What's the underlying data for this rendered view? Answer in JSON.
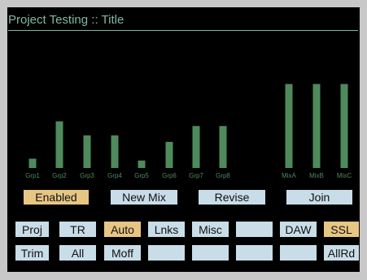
{
  "header": {
    "title": "Project Testing  ::  Title"
  },
  "colors": {
    "background": "#000000",
    "accent": "#7fb8a8",
    "bar": "#4f8a5c",
    "button_light": "#c9dde8",
    "button_active": "#e7c684"
  },
  "chart_data": {
    "type": "bar",
    "categories": [
      "Grp1",
      "Grp2",
      "Grp3",
      "Grp4",
      "Grp5",
      "Grp6",
      "Grp7",
      "Grp8",
      "MixA",
      "MixB",
      "MixC"
    ],
    "values": [
      0.1,
      0.5,
      0.35,
      0.35,
      0.08,
      0.28,
      0.45,
      0.45,
      0.9,
      0.9,
      0.9
    ],
    "ylim": [
      0,
      1
    ]
  },
  "actions": [
    {
      "label": "Enabled",
      "active": true
    },
    {
      "label": "New Mix",
      "active": false
    },
    {
      "label": "Revise",
      "active": false
    },
    {
      "label": "Join",
      "active": false
    }
  ],
  "grid": {
    "row1": [
      {
        "label": "Proj",
        "active": false
      },
      {
        "label": "TR",
        "active": false
      },
      {
        "label": "Auto",
        "active": true
      },
      {
        "label": "Lnks",
        "active": false
      },
      {
        "label": "Misc",
        "active": false
      },
      {
        "label": "",
        "active": false
      },
      {
        "label": "DAW",
        "active": false
      },
      {
        "label": "SSL",
        "active": true
      }
    ],
    "row2": [
      {
        "label": "Trim",
        "active": false
      },
      {
        "label": "All",
        "active": false
      },
      {
        "label": "Moff",
        "active": false
      },
      {
        "label": "",
        "active": false
      },
      {
        "label": "",
        "active": false
      },
      {
        "label": "",
        "active": false
      },
      {
        "label": "",
        "active": false
      },
      {
        "label": "AllRd",
        "active": false
      }
    ]
  }
}
